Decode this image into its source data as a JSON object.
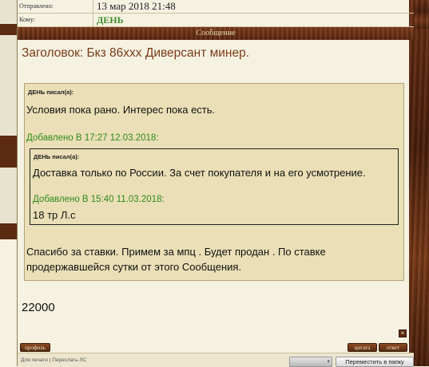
{
  "header": {
    "sent_label": "Отправлено:",
    "sent_value": "13 мар 2018 21:48",
    "to_label": "Кому:",
    "to_value": "ДЕНЬ"
  },
  "message_bar": {
    "label": "Сообщение"
  },
  "subject": "Заголовок: Бкз 86ххх Диверсант минер.",
  "quote": {
    "author": "ДЕНЬ писал(а):",
    "text": "Условия пока рано. Интерес пока есть.",
    "added": "Добавлено В 17:27 12.03.2018:",
    "inner": {
      "author": "ДЕНЬ писал(а):",
      "text": "Доставка только по России. За счет покупателя и на его усмотрение.",
      "added": "Добавлено В 15:40 11.03.2018:",
      "text2": "18 тр Л.с"
    },
    "after": "Спасибо за ставки. Примем за мпц . Будет продан . По ставке продержавшейся сутки от этого Сообщения."
  },
  "price": "22000",
  "buttons": {
    "profile": "профиль",
    "quote": "цитата",
    "reply": "ответ",
    "close": "×"
  },
  "footer": {
    "print_link": "Для печати | Переслать ЛС",
    "folder_select": "",
    "move_button": "Переместить в папку"
  },
  "colors": {
    "wood": "#5a260e",
    "subject": "#7a3a18",
    "added_green": "#2e8b1e",
    "username_green": "#3d8c2a"
  }
}
